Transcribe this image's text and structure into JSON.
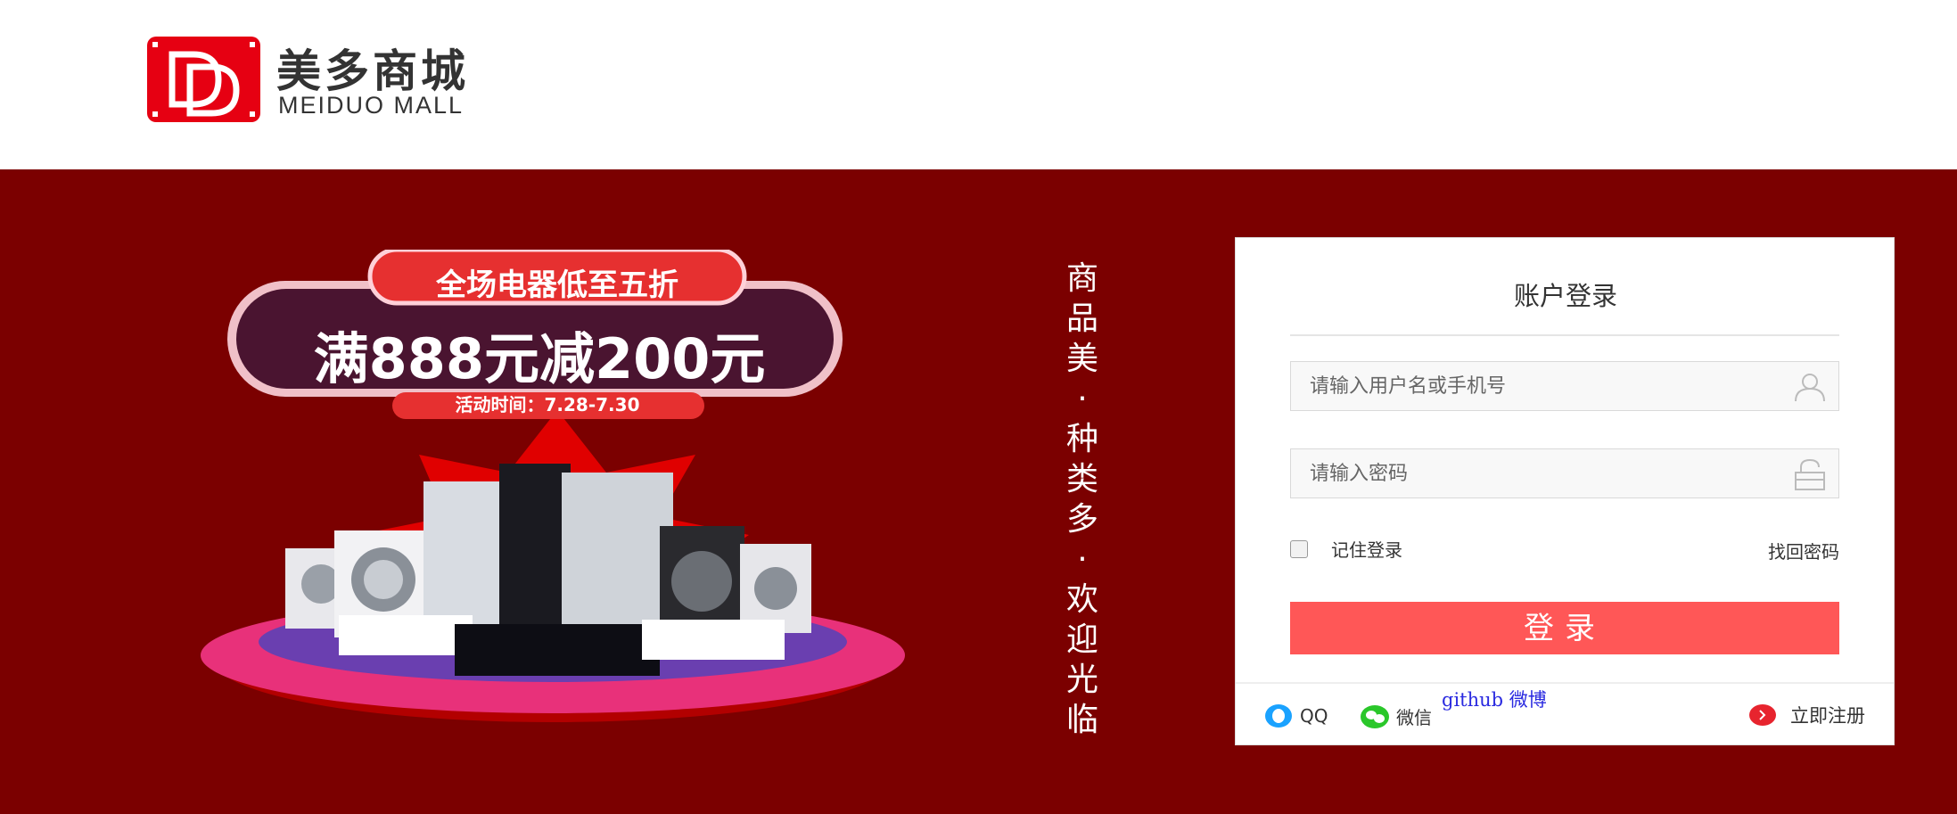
{
  "header": {
    "logo_mark": "DD",
    "logo_title": "美多商城",
    "logo_subtitle": "MEIDUO MALL"
  },
  "promo": {
    "top_text": "全场电器低至五折",
    "main_text": "满888元减200元",
    "date_text": "活动时间：7.28-7.30"
  },
  "slogan": [
    "商",
    "品",
    "美",
    "·",
    "种",
    "类",
    "多",
    "·",
    "欢",
    "迎",
    "光",
    "临"
  ],
  "login": {
    "title": "账户登录",
    "username_placeholder": "请输入用户名或手机号",
    "password_placeholder": "请输入密码",
    "remember_label": "记住登录",
    "forgot_label": "找回密码",
    "submit_label": "登录",
    "qq_label": "QQ",
    "wechat_label": "微信",
    "github_weibo_label": "github 微博",
    "register_label": "立即注册"
  },
  "colors": {
    "brand_red": "#e60012",
    "banner_bg": "#7b0000",
    "login_button": "#ff5757",
    "qq_blue": "#1aa2ff",
    "wechat_green": "#2ac72a",
    "register_red": "#e7242e"
  },
  "icons": {
    "username": "user-icon",
    "password": "lock-icon",
    "qq": "qq-icon",
    "wechat": "wechat-icon",
    "register": "arrow-right-icon"
  }
}
